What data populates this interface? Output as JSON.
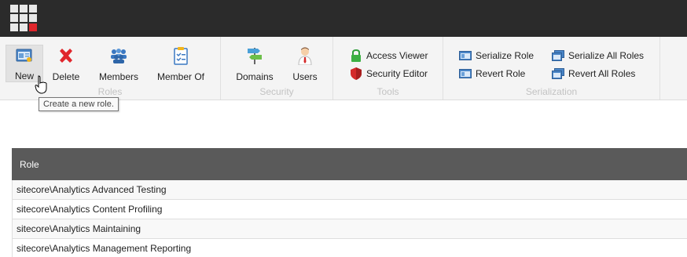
{
  "ribbon": {
    "groups": {
      "roles": {
        "caption": "Roles",
        "new_label": "New",
        "delete_label": "Delete",
        "members_label": "Members",
        "member_of_label": "Member Of"
      },
      "security": {
        "caption": "Security",
        "domains_label": "Domains",
        "users_label": "Users"
      },
      "tools": {
        "caption": "Tools",
        "access_viewer_label": "Access Viewer",
        "security_editor_label": "Security Editor"
      },
      "serialization": {
        "caption": "Serialization",
        "serialize_role_label": "Serialize Role",
        "revert_role_label": "Revert Role",
        "serialize_all_roles_label": "Serialize All Roles",
        "revert_all_roles_label": "Revert All Roles"
      }
    }
  },
  "tooltip": {
    "text": "Create a new role."
  },
  "grid": {
    "header": "Role",
    "rows": [
      "sitecore\\Analytics Advanced Testing",
      "sitecore\\Analytics Content Profiling",
      "sitecore\\Analytics Maintaining",
      "sitecore\\Analytics Management Reporting"
    ]
  },
  "colors": {
    "topbar": "#2b2b2b",
    "ribbon": "#f4f4f4",
    "grid_header": "#5a5a5a",
    "accent_red": "#e0262c"
  },
  "icons": {
    "app_launcher": "app-grid-icon",
    "new": "new-role-icon",
    "delete": "delete-x-icon",
    "members": "members-icon",
    "member_of": "member-of-clipboard-icon",
    "domains": "domains-signpost-icon",
    "users": "user-icon",
    "access_viewer": "lock-icon",
    "security_editor": "shield-icon",
    "serialize": "serialize-icon",
    "revert": "revert-icon"
  }
}
